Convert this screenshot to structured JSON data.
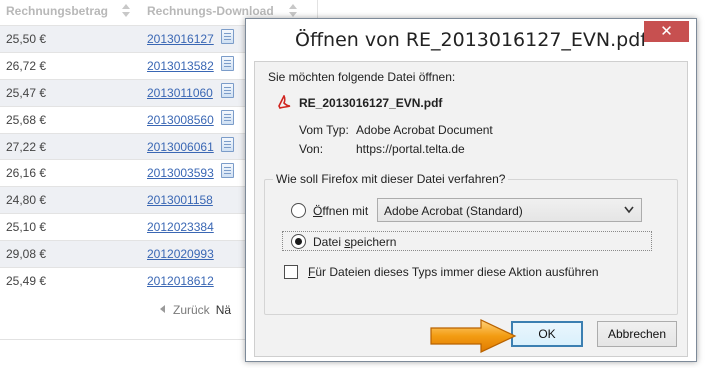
{
  "invoice_table": {
    "columns": [
      "Rechnungsbetrag",
      "Rechnungs-Download"
    ],
    "rows": [
      {
        "amount": "25,50 €",
        "invoice": "2013016127",
        "has_icon": true
      },
      {
        "amount": "26,72 €",
        "invoice": "2013013582",
        "has_icon": true
      },
      {
        "amount": "25,47 €",
        "invoice": "2013011060",
        "has_icon": true
      },
      {
        "amount": "25,68 €",
        "invoice": "2013008560",
        "has_icon": true
      },
      {
        "amount": "27,22 €",
        "invoice": "2013006061",
        "has_icon": true
      },
      {
        "amount": "26,16 €",
        "invoice": "2013003593",
        "has_icon": true
      },
      {
        "amount": "24,80 €",
        "invoice": "2013001158",
        "has_icon": false
      },
      {
        "amount": "25,10 €",
        "invoice": "2012023384",
        "has_icon": false
      },
      {
        "amount": "29,08 €",
        "invoice": "2012020993",
        "has_icon": false
      },
      {
        "amount": "25,49 €",
        "invoice": "2012018612",
        "has_icon": false
      }
    ],
    "pager": {
      "back_label": "Zurück",
      "next_label": "Nä"
    }
  },
  "dialog": {
    "title": "Öffnen von RE_2013016127_EVN.pdf",
    "close_symbol": "✕",
    "prompt": "Sie möchten folgende Datei öffnen:",
    "filename": "RE_2013016127_EVN.pdf",
    "type_label": "Vom Typ:",
    "type_value": "Adobe Acrobat Document",
    "from_label": "Von:",
    "from_value": "https://portal.telta.de",
    "question": "Wie soll Firefox mit dieser Datei verfahren?",
    "open_with_first_letter": "Ö",
    "open_with_rest": "ffnen mit",
    "open_with_app": "Adobe Acrobat  (Standard)",
    "save_label_before": "Datei ",
    "save_label_accel": "s",
    "save_label_after": "peichern",
    "selected_option": "save",
    "remember_first_letter": "F",
    "remember_rest": "ür Dateien dieses Typs immer diese Aktion ausführen",
    "remember_checked": false,
    "ok_label": "OK",
    "cancel_label": "Abbrechen"
  },
  "colors": {
    "close_button": "#c75050",
    "link": "#3a67b4",
    "pointer_arrow": "#f39c12",
    "default_button_border": "#3c7fb1"
  },
  "icons": [
    "sort-icon",
    "document-icon",
    "pdf-icon",
    "chevron-down-icon",
    "back-arrow-icon",
    "close-icon",
    "pointer-arrow-icon"
  ]
}
